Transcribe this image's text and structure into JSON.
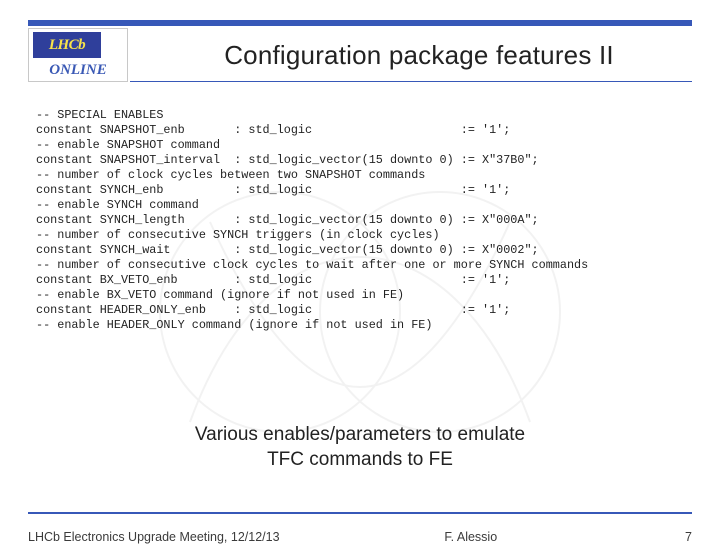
{
  "logo": {
    "top": "LHCb",
    "side": "",
    "bottom": "ONLINE"
  },
  "title": "Configuration package features II",
  "code_lines": [
    "-- SPECIAL ENABLES",
    "constant SNAPSHOT_enb       : std_logic                     := '1';",
    "-- enable SNAPSHOT command",
    "constant SNAPSHOT_interval  : std_logic_vector(15 downto 0) := X\"37B0\";",
    "-- number of clock cycles between two SNAPSHOT commands",
    "constant SYNCH_enb          : std_logic                     := '1';",
    "-- enable SYNCH command",
    "constant SYNCH_length       : std_logic_vector(15 downto 0) := X\"000A\";",
    "-- number of consecutive SYNCH triggers (in clock cycles)",
    "constant SYNCH_wait         : std_logic_vector(15 downto 0) := X\"0002\";",
    "-- number of consecutive clock cycles to wait after one or more SYNCH commands",
    "constant BX_VETO_enb        : std_logic                     := '1';",
    "-- enable BX_VETO command (ignore if not used in FE)",
    "constant HEADER_ONLY_enb    : std_logic                     := '1';",
    "-- enable HEADER_ONLY command (ignore if not used in FE)"
  ],
  "caption": {
    "line1": "Various enables/parameters to emulate",
    "line2": "TFC commands to FE"
  },
  "footer": {
    "left": "LHCb Electronics Upgrade Meeting, 12/12/13",
    "center": "F. Alessio",
    "page": "7"
  }
}
